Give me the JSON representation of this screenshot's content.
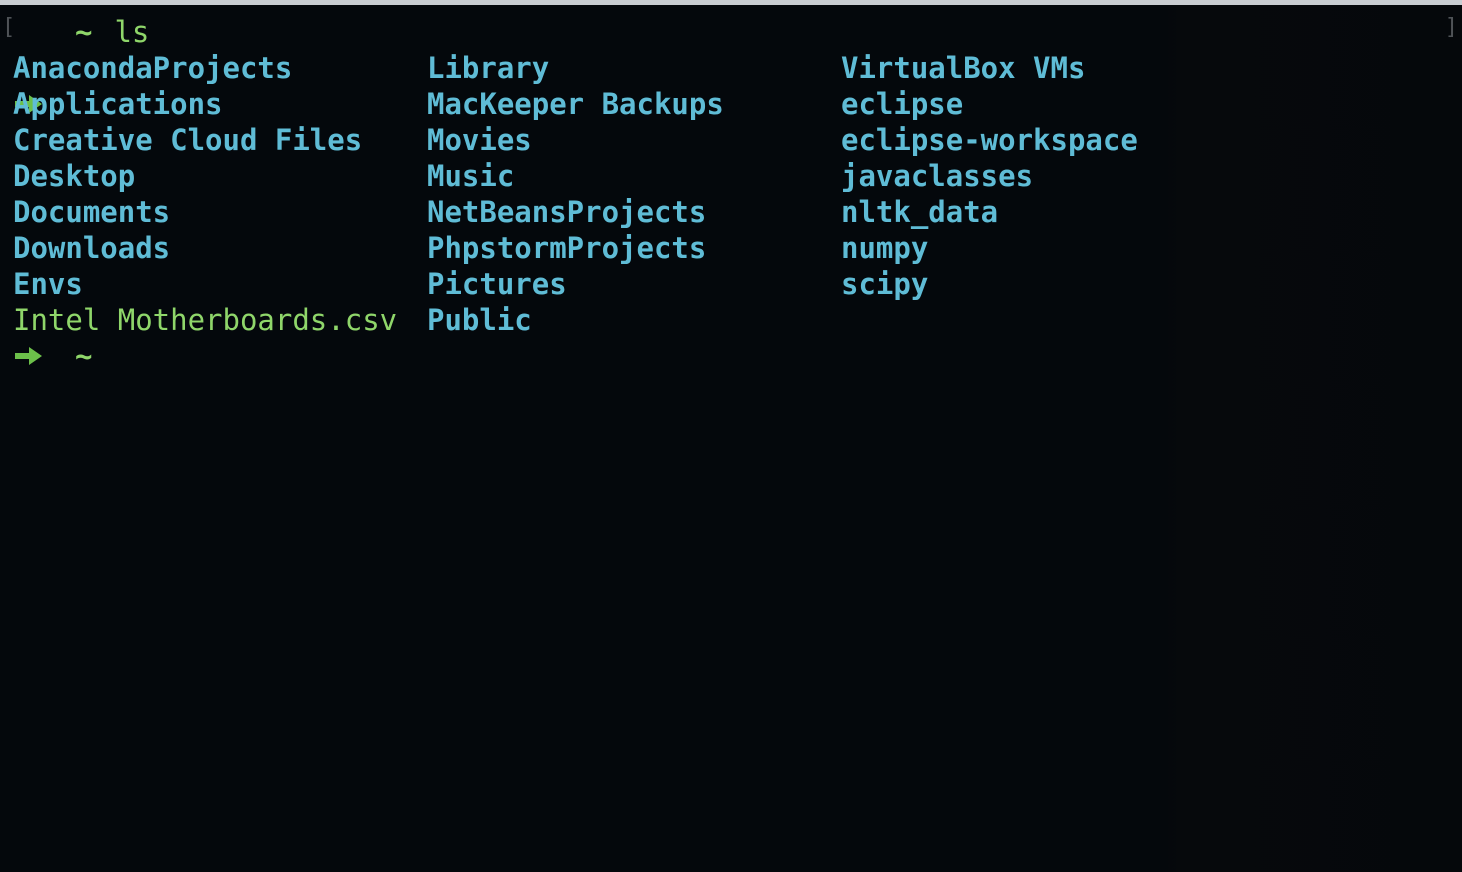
{
  "colors": {
    "background": "#04080c",
    "directory": "#5fbcd6",
    "file": "#8fd66a",
    "prompt_arrow": "#6cc04a"
  },
  "prompt": {
    "symbol_icon": "right-arrow-icon",
    "cwd": "~",
    "command": "ls"
  },
  "listing": {
    "columns": [
      [
        {
          "name": "AnacondaProjects",
          "kind": "directory"
        },
        {
          "name": "Applications",
          "kind": "directory"
        },
        {
          "name": "Creative Cloud Files",
          "kind": "directory"
        },
        {
          "name": "Desktop",
          "kind": "directory"
        },
        {
          "name": "Documents",
          "kind": "directory"
        },
        {
          "name": "Downloads",
          "kind": "directory"
        },
        {
          "name": "Envs",
          "kind": "directory"
        },
        {
          "name": "Intel Motherboards.csv",
          "kind": "file"
        }
      ],
      [
        {
          "name": "Library",
          "kind": "directory"
        },
        {
          "name": "MacKeeper Backups",
          "kind": "directory"
        },
        {
          "name": "Movies",
          "kind": "directory"
        },
        {
          "name": "Music",
          "kind": "directory"
        },
        {
          "name": "NetBeansProjects",
          "kind": "directory"
        },
        {
          "name": "PhpstormProjects",
          "kind": "directory"
        },
        {
          "name": "Pictures",
          "kind": "directory"
        },
        {
          "name": "Public",
          "kind": "directory"
        }
      ],
      [
        {
          "name": "VirtualBox VMs",
          "kind": "directory"
        },
        {
          "name": "eclipse",
          "kind": "directory"
        },
        {
          "name": "eclipse-workspace",
          "kind": "directory"
        },
        {
          "name": "javaclasses",
          "kind": "directory"
        },
        {
          "name": "nltk_data",
          "kind": "directory"
        },
        {
          "name": "numpy",
          "kind": "directory"
        },
        {
          "name": "scipy",
          "kind": "directory"
        }
      ]
    ]
  },
  "next_prompt": {
    "symbol_icon": "right-arrow-icon",
    "cwd": "~"
  }
}
